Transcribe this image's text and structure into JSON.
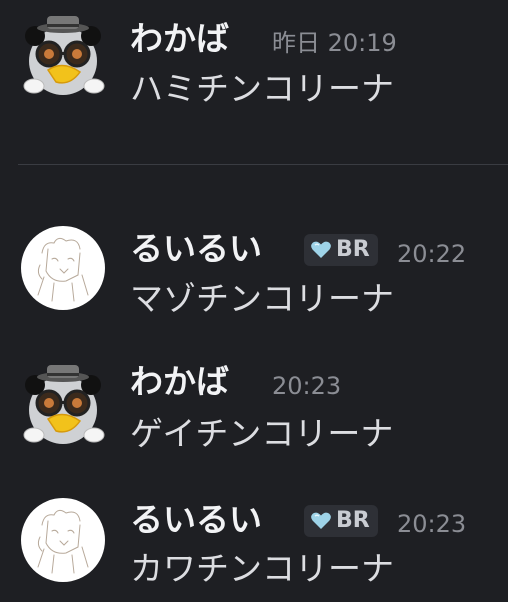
{
  "messages": [
    {
      "avatar": "panda-sunglasses-avatar",
      "username": "わかば",
      "timestamp": "昨日 20:19",
      "text": "ハミチンコリーナ"
    },
    {
      "avatar": "sketch-figure-avatar",
      "username": "るいるい",
      "badge": {
        "icon": "heart-icon",
        "label": "BR",
        "color": "#9ed3e8"
      },
      "timestamp": "20:22",
      "text": "マゾチンコリーナ"
    },
    {
      "avatar": "panda-sunglasses-avatar",
      "username": "わかば",
      "timestamp": "20:23",
      "text": "ゲイチンコリーナ"
    },
    {
      "avatar": "sketch-figure-avatar",
      "username": "るいるい",
      "badge": {
        "icon": "heart-icon",
        "label": "BR",
        "color": "#9ed3e8"
      },
      "timestamp": "20:23",
      "text": "カワチンコリーナ"
    }
  ]
}
